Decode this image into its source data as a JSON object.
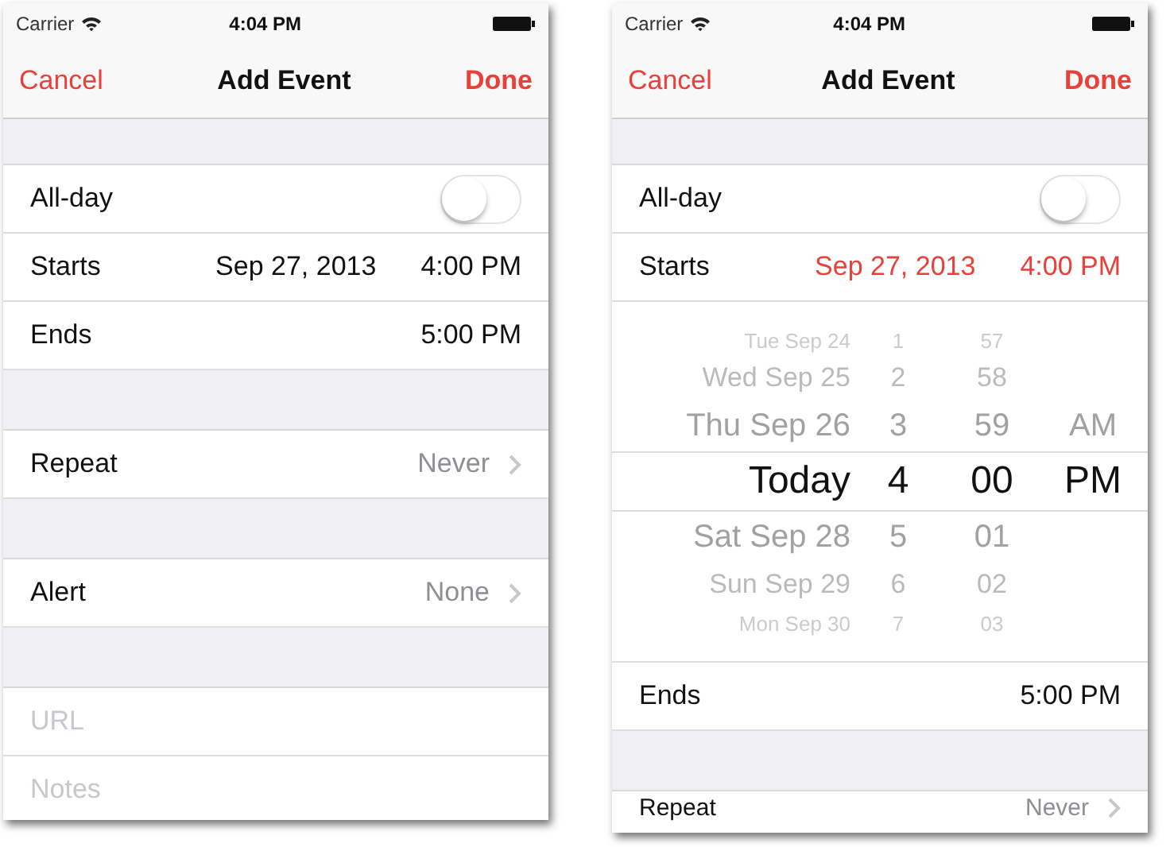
{
  "phones": [
    {
      "status": {
        "carrier": "Carrier",
        "time": "4:04 PM"
      },
      "nav": {
        "cancel": "Cancel",
        "title": "Add Event",
        "done": "Done"
      },
      "items": [
        {
          "kind": "gap"
        },
        {
          "kind": "toggle",
          "label": "All-day",
          "on": false
        },
        {
          "kind": "datetime",
          "label": "Starts",
          "date": "Sep 27, 2013",
          "time": "4:00 PM",
          "active": false
        },
        {
          "kind": "datetime",
          "label": "Ends",
          "time": "5:00 PM",
          "active": false
        },
        {
          "kind": "gap"
        },
        {
          "kind": "disclosure",
          "label": "Repeat",
          "value": "Never",
          "cut": false
        },
        {
          "kind": "gap"
        },
        {
          "kind": "disclosure",
          "label": "Alert",
          "value": "None",
          "cut": false
        },
        {
          "kind": "gap"
        },
        {
          "kind": "placeholder",
          "placeholder": "URL"
        },
        {
          "kind": "placeholder",
          "placeholder": "Notes"
        }
      ]
    },
    {
      "status": {
        "carrier": "Carrier",
        "time": "4:04 PM"
      },
      "nav": {
        "cancel": "Cancel",
        "title": "Add Event",
        "done": "Done"
      },
      "items": [
        {
          "kind": "gap"
        },
        {
          "kind": "toggle",
          "label": "All-day",
          "on": false
        },
        {
          "kind": "datetime",
          "label": "Starts",
          "date": "Sep 27, 2013",
          "time": "4:00 PM",
          "active": true
        },
        {
          "kind": "picker",
          "rows": [
            {
              "date": "Tue Sep 24",
              "hour": "1",
              "minute": "57",
              "selected": false
            },
            {
              "date": "Wed Sep 25",
              "hour": "2",
              "minute": "58",
              "selected": false
            },
            {
              "date": "Thu Sep 26",
              "hour": "3",
              "minute": "59",
              "period": "AM",
              "selected": false
            },
            {
              "date": "Today",
              "hour": "4",
              "minute": "00",
              "period": "PM",
              "selected": true
            },
            {
              "date": "Sat Sep 28",
              "hour": "5",
              "minute": "01",
              "selected": false
            },
            {
              "date": "Sun Sep 29",
              "hour": "6",
              "minute": "02",
              "selected": false
            },
            {
              "date": "Mon Sep 30",
              "hour": "7",
              "minute": "03",
              "selected": false
            }
          ]
        },
        {
          "kind": "datetime",
          "label": "Ends",
          "time": "5:00 PM",
          "active": false
        },
        {
          "kind": "gap"
        },
        {
          "kind": "disclosure",
          "label": "Repeat",
          "value": "Never",
          "cut": true
        }
      ]
    }
  ]
}
